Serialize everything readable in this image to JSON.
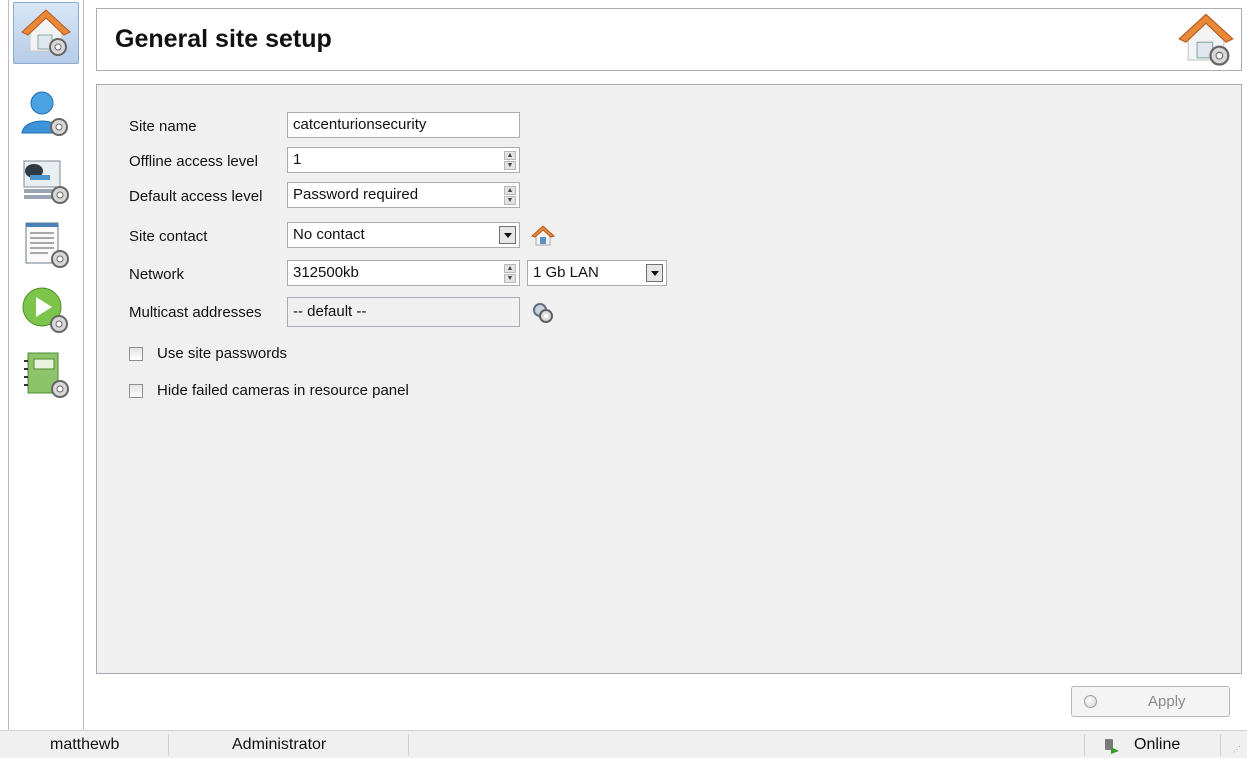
{
  "header": {
    "title": "General site setup",
    "icon": "house-gear-icon"
  },
  "sidebar": {
    "items": [
      {
        "name": "site-setup",
        "icon": "house-gear-icon",
        "active": true
      },
      {
        "name": "users",
        "icon": "user-gear-icon",
        "active": false
      },
      {
        "name": "cameras",
        "icon": "camera-gear-icon",
        "active": false
      },
      {
        "name": "lists",
        "icon": "list-gear-icon",
        "active": false
      },
      {
        "name": "playback",
        "icon": "play-gear-icon",
        "active": false
      },
      {
        "name": "notebook",
        "icon": "notebook-gear-icon",
        "active": false
      }
    ]
  },
  "form": {
    "site_name": {
      "label": "Site name",
      "value": "catcenturionsecurity"
    },
    "offline_access": {
      "label": "Offline access level",
      "value": "1"
    },
    "default_access": {
      "label": "Default access level",
      "value": "Password required"
    },
    "site_contact": {
      "label": "Site contact",
      "value": "No contact"
    },
    "network": {
      "label": "Network",
      "value": "312500kb",
      "lan_value": "1 Gb LAN"
    },
    "multicast": {
      "label": "Multicast addresses",
      "value": "-- default --"
    },
    "use_site_passwords": {
      "label": "Use site passwords",
      "checked": false
    },
    "hide_failed": {
      "label": "Hide failed cameras in resource panel",
      "checked": false
    }
  },
  "apply_label": "Apply",
  "status": {
    "user": "matthewb",
    "role": "Administrator",
    "connection": "Online"
  }
}
